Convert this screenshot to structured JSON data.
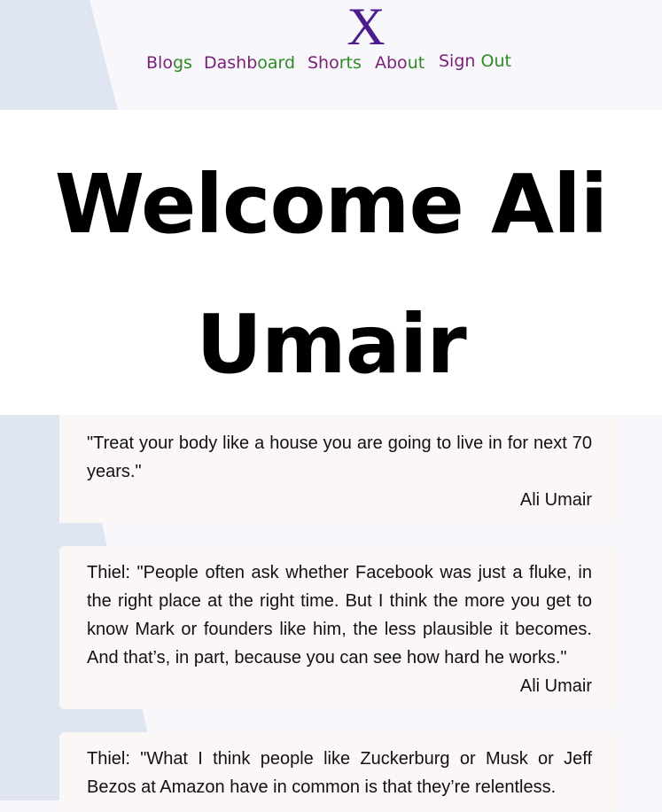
{
  "header": {
    "logo": "X",
    "nav": [
      {
        "label_part1": "Blo",
        "label_part2": "gs"
      },
      {
        "label_part1": "Dashb",
        "label_part2": "oard"
      },
      {
        "label_part1": "Sho",
        "label_part2": "rts"
      },
      {
        "label_part1": "Abo",
        "label_part2": "ut"
      },
      {
        "label_part1": "Sign ",
        "label_part2": "Out"
      }
    ]
  },
  "welcome": {
    "line1": "Welcome Ali",
    "line2": "Umair"
  },
  "shorts": [
    {
      "quote": "\"Treat your body like a house you are going to live in for next 70 years.\"",
      "author": "Ali Umair"
    },
    {
      "quote": "Thiel: \"People often ask whether Facebook was just a fluke, in the right place at the right time. But I think the more you get to know Mark or founders like him, the less plausible it becomes. And that’s, in part, because you can see how hard he works.\"",
      "author": "Ali Umair"
    },
    {
      "quote": "Thiel: \"What I think people like Zuckerburg or Musk or Jeff Bezos at Amazon have in common is that they’re relentless.",
      "author": ""
    }
  ],
  "colors": {
    "logo": "#4b1c8c",
    "nav_purple": "#7a1f78",
    "nav_green": "#2e8a24",
    "background": "#f8f8fc",
    "background_shape": "#dfe6f2",
    "card": "#fcf7f7"
  }
}
